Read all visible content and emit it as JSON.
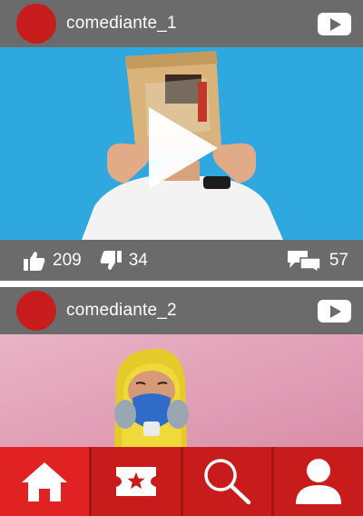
{
  "posts": [
    {
      "username": "comediante_1",
      "likes": "209",
      "dislikes": "34",
      "comments": "57"
    },
    {
      "username": "comediante_2"
    }
  ],
  "colors": {
    "header_bg": "#6b6b6b",
    "avatar": "#c81d1d",
    "nav_bg": "#c81b1b",
    "nav_active": "#e02222"
  },
  "icons": {
    "post_source": "youtube-icon",
    "play": "play-icon",
    "like": "thumbs-up-icon",
    "dislike": "thumbs-down-icon",
    "comments": "comments-icon",
    "nav": [
      "home-icon",
      "ticket-star-icon",
      "search-icon",
      "user-icon"
    ]
  }
}
